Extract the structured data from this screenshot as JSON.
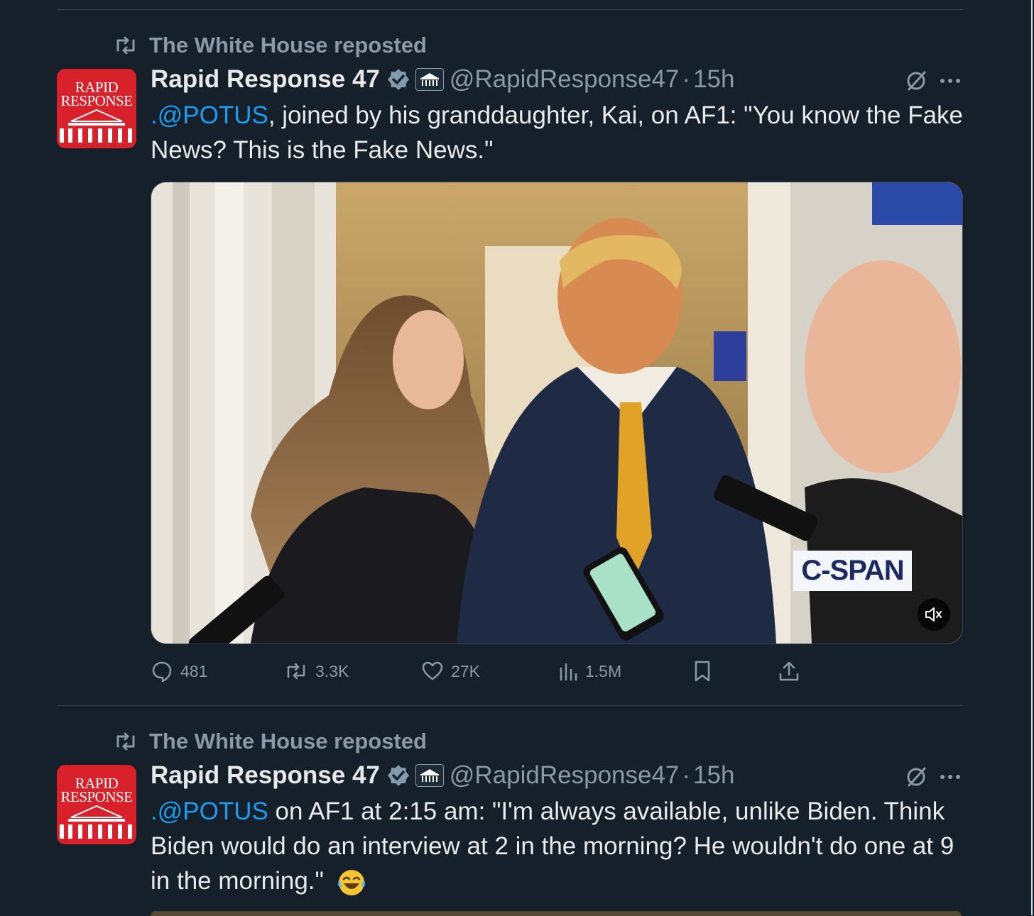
{
  "posts": [
    {
      "repost_label": "The White House reposted",
      "avatar": {
        "line1": "RAPID",
        "line2": "RESPONSE"
      },
      "author_name": "Rapid Response 47",
      "handle": "@RapidResponse47",
      "separator": "·",
      "time": "15h",
      "text_mention": ".@POTUS",
      "text_body": ", joined by his granddaughter, Kai, on AF1: \"You know the Fake News? This is the Fake News.\"",
      "media": {
        "logo": "C-SPAN",
        "mute_icon": "muted-speaker-icon"
      },
      "actions": {
        "replies": "481",
        "reposts": "3.3K",
        "likes": "27K",
        "views": "1.5M"
      }
    },
    {
      "repost_label": "The White House reposted",
      "avatar": {
        "line1": "RAPID",
        "line2": "RESPONSE"
      },
      "author_name": "Rapid Response 47",
      "handle": "@RapidResponse47",
      "separator": "·",
      "time": "15h",
      "text_mention": ".@POTUS",
      "text_body": " on AF1 at 2:15 am: \"I'm always available, unlike Biden. Think Biden would do an interview at 2 in the morning? He wouldn't do one at 9 in the morning.\"",
      "emoji": "face-with-tears-of-joy"
    }
  ],
  "colors": {
    "background": "#15202b",
    "accent": "#1d9bf0",
    "muted_text": "#8b98a5",
    "avatar_red": "#d8212a"
  }
}
